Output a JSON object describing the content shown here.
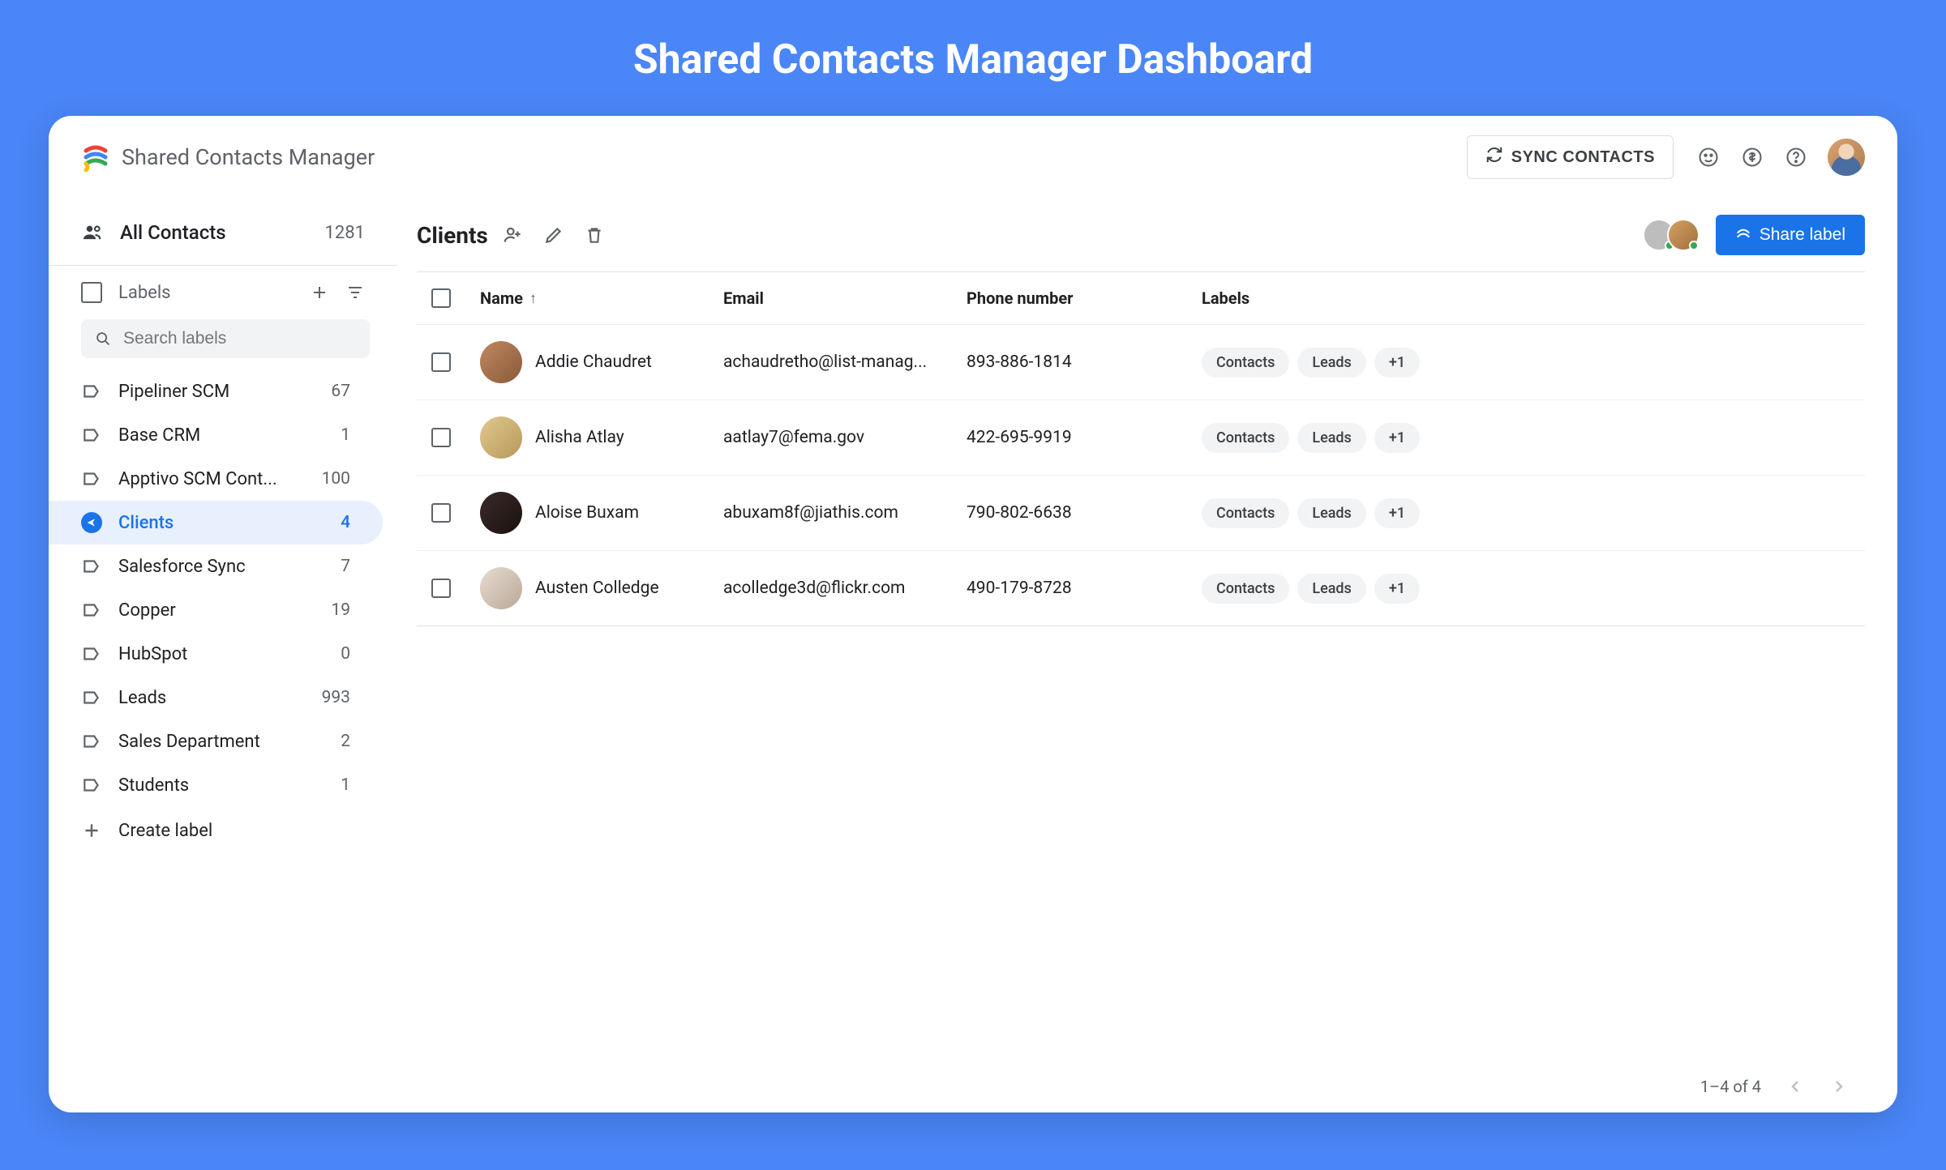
{
  "page_heading": "Shared Contacts Manager Dashboard",
  "brand": "Shared Contacts Manager",
  "header": {
    "sync_label": "SYNC CONTACTS"
  },
  "sidebar": {
    "all_contacts_label": "All Contacts",
    "all_contacts_count": "1281",
    "labels_header": "Labels",
    "search_placeholder": "Search labels",
    "create_label": "Create label",
    "labels": [
      {
        "name": "Pipeliner SCM",
        "count": "67",
        "active": false
      },
      {
        "name": "Base CRM",
        "count": "1",
        "active": false
      },
      {
        "name": "Apptivo SCM Cont...",
        "count": "100",
        "active": false
      },
      {
        "name": "Clients",
        "count": "4",
        "active": true
      },
      {
        "name": "Salesforce Sync",
        "count": "7",
        "active": false
      },
      {
        "name": "Copper",
        "count": "19",
        "active": false
      },
      {
        "name": "HubSpot",
        "count": "0",
        "active": false
      },
      {
        "name": "Leads",
        "count": "993",
        "active": false
      },
      {
        "name": "Sales Department",
        "count": "2",
        "active": false
      },
      {
        "name": "Students",
        "count": "1",
        "active": false
      }
    ]
  },
  "main": {
    "title": "Clients",
    "share_button": "Share label",
    "columns": {
      "name": "Name",
      "email": "Email",
      "phone": "Phone number",
      "labels": "Labels"
    },
    "rows": [
      {
        "name": "Addie Chaudret",
        "email": "achaudretho@list-manag...",
        "phone": "893-886-1814",
        "labels": [
          "Contacts",
          "Leads",
          "+1"
        ]
      },
      {
        "name": "Alisha Atlay",
        "email": "aatlay7@fema.gov",
        "phone": "422-695-9919",
        "labels": [
          "Contacts",
          "Leads",
          "+1"
        ]
      },
      {
        "name": "Aloise Buxam",
        "email": "abuxam8f@jiathis.com",
        "phone": "790-802-6638",
        "labels": [
          "Contacts",
          "Leads",
          "+1"
        ]
      },
      {
        "name": "Austen Colledge",
        "email": "acolledge3d@flickr.com",
        "phone": "490-179-8728",
        "labels": [
          "Contacts",
          "Leads",
          "+1"
        ]
      }
    ],
    "pagination": "1–4 of 4"
  }
}
